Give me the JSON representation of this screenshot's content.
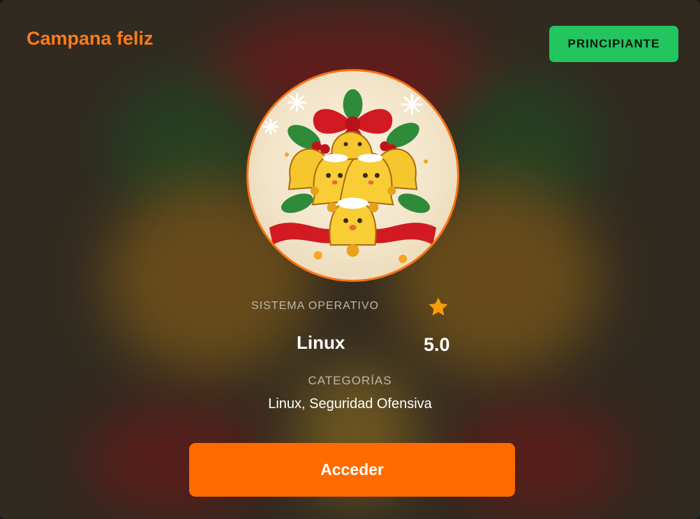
{
  "card": {
    "title": "Campana feliz",
    "level_badge": "PRINCIPIANTE",
    "avatar_icon": "christmas-bells-icon",
    "os": {
      "label": "SISTEMA OPERATIVO",
      "value": "Linux"
    },
    "rating": {
      "icon": "star-icon",
      "value": "5.0"
    },
    "categories": {
      "label": "CATEGORÍAS",
      "value": "Linux, Seguridad Ofensiva"
    },
    "access_button": "Acceder"
  },
  "colors": {
    "accent": "#ff6b00",
    "title": "#ff7a1a",
    "badge": "#22c55e",
    "star": "#f59e0b"
  }
}
